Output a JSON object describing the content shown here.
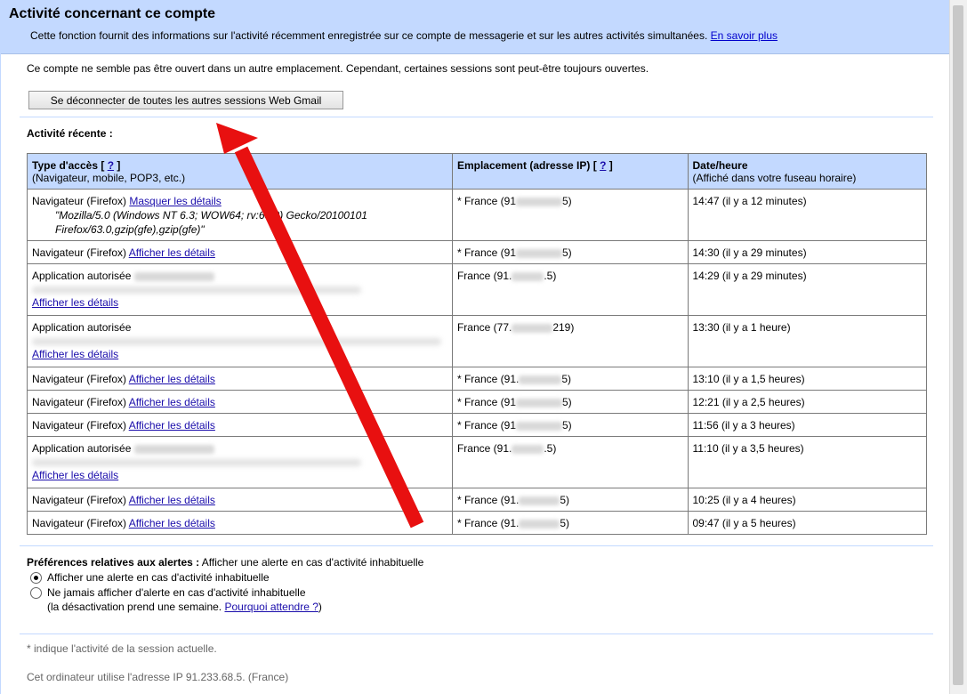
{
  "header": {
    "title": "Activité concernant ce compte",
    "description": "Cette fonction fournit des informations sur l'activité récemment enregistrée sur ce compte de messagerie et sur les autres activités simultanées.",
    "learn_more": "En savoir plus"
  },
  "notice": "Ce compte ne semble pas être ouvert dans un autre emplacement. Cependant, certaines sessions sont peut-être toujours ouvertes.",
  "logout_button": "Se déconnecter de toutes les autres sessions Web Gmail",
  "recent_label": "Activité récente :",
  "table": {
    "col1_title": "Type d'accès",
    "col1_sub": "(Navigateur, mobile, POP3, etc.)",
    "col2_title": "Emplacement (adresse IP)",
    "col3_title": "Date/heure",
    "col3_sub": "(Affiché dans votre fuseau horaire)",
    "help_link": "?",
    "rows": [
      {
        "type": "Navigateur (Firefox)",
        "link": "Masquer les détails",
        "ua1": "\"Mozilla/5.0 (Windows NT 6.3; WOW64; rv:63.0) Gecko/20100101",
        "ua2": "Firefox/63.0,gzip(gfe),gzip(gfe)\"",
        "loc_prefix": "* France (91",
        "loc_suffix": "5)",
        "time": "14:47 (il y a 12 minutes)"
      },
      {
        "type": "Navigateur (Firefox)",
        "link": "Afficher les détails",
        "loc_prefix": "* France (91",
        "loc_suffix": "5)",
        "time": "14:30 (il y a 29 minutes)"
      },
      {
        "type": "Application autorisée",
        "link": "Afficher les détails",
        "loc_prefix": "France (91.",
        "loc_suffix": ".5)",
        "time": "14:29 (il y a 29 minutes)"
      },
      {
        "type": "Application autorisée",
        "link": "Afficher les détails",
        "loc_prefix": "France (77.",
        "loc_suffix": "219)",
        "time": "13:30 (il y a 1 heure)"
      },
      {
        "type": "Navigateur (Firefox)",
        "link": "Afficher les détails",
        "loc_prefix": "* France (91.",
        "loc_suffix": "5)",
        "time": "13:10 (il y a 1,5 heures)"
      },
      {
        "type": "Navigateur (Firefox)",
        "link": "Afficher les détails",
        "loc_prefix": "* France (91",
        "loc_suffix": "5)",
        "time": "12:21 (il y a 2,5 heures)"
      },
      {
        "type": "Navigateur (Firefox)",
        "link": "Afficher les détails",
        "loc_prefix": "* France (91",
        "loc_suffix": "5)",
        "time": "11:56 (il y a 3 heures)"
      },
      {
        "type": "Application autorisée",
        "link": "Afficher les détails",
        "loc_prefix": "France (91.",
        "loc_suffix": ".5)",
        "time": "11:10 (il y a 3,5 heures)"
      },
      {
        "type": "Navigateur (Firefox)",
        "link": "Afficher les détails",
        "loc_prefix": "* France (91.",
        "loc_suffix": "5)",
        "time": "10:25 (il y a 4 heures)"
      },
      {
        "type": "Navigateur (Firefox)",
        "link": "Afficher les détails",
        "loc_prefix": "* France (91.",
        "loc_suffix": "5)",
        "time": "09:47 (il y a 5 heures)"
      }
    ]
  },
  "prefs": {
    "label": "Préférences relatives aux alertes :",
    "label_rest": "Afficher une alerte en cas d'activité inhabituelle",
    "option1": "Afficher une alerte en cas d'activité inhabituelle",
    "option2": "Ne jamais afficher d'alerte en cas d'activité inhabituelle",
    "note": "(la désactivation prend une semaine.",
    "why_link": "Pourquoi attendre ?",
    "note_end": ")",
    "selected": "option1"
  },
  "footnote1": "* indique l'activité de la session actuelle.",
  "footnote2": "Cet ordinateur utilise l'adresse IP 91.233.68.5. (France)",
  "colors": {
    "header_bg": "#c3d9ff",
    "link": "#1a0dab",
    "arrow": "#e81010"
  }
}
